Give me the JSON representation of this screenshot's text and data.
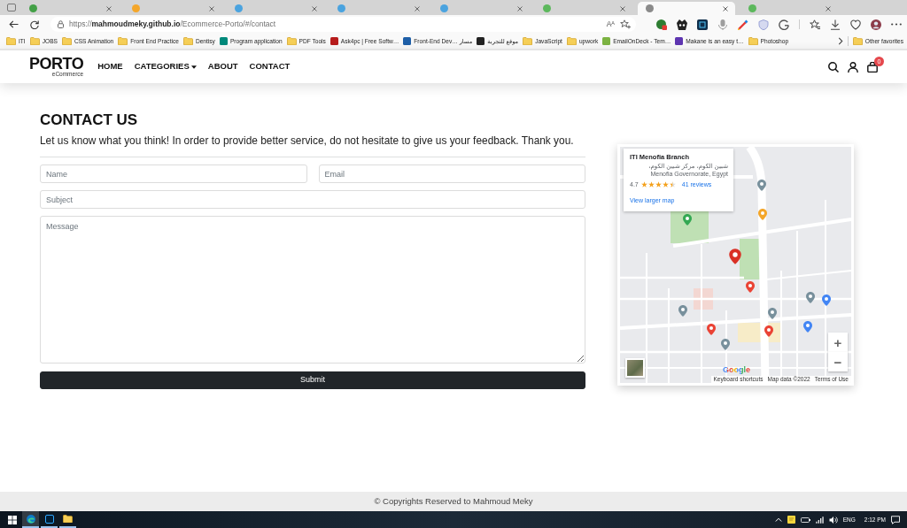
{
  "browser": {
    "tabs": [
      {
        "color": "#43a047",
        "selected": false
      },
      {
        "color": "#f4a62a",
        "selected": false
      },
      {
        "color": "#4aa3df",
        "selected": false
      },
      {
        "color": "#4aa3df",
        "selected": false
      },
      {
        "color": "#4aa3df",
        "selected": false
      },
      {
        "color": "#5cb85c",
        "selected": false
      },
      {
        "color": "#8a8a8a",
        "selected": true
      },
      {
        "color": "#5cb85c",
        "selected": false
      }
    ],
    "address": {
      "url": "https://**mahmoudmeky.github.io**/Ecommerce-Porto/#/contact"
    },
    "read_aloud": "A$^{A}$",
    "bookmarks": [
      {
        "label": "ITI",
        "kind": "folder"
      },
      {
        "label": "JOBS",
        "kind": "folder"
      },
      {
        "label": "CSS Animation",
        "kind": "folder"
      },
      {
        "label": "Front End Practice",
        "kind": "folder"
      },
      {
        "label": "Dentisy",
        "kind": "folder"
      },
      {
        "label": "Program application",
        "kind": "site",
        "color": "#00897b"
      },
      {
        "label": "PDF Tools",
        "kind": "folder"
      },
      {
        "label": "Ask4pc | Free Softw…",
        "kind": "site",
        "color": "#b71c1c"
      },
      {
        "label": "Front-End Dev… مسار",
        "kind": "site",
        "color": "#1e5fa8"
      },
      {
        "label": "موقع للتجربة",
        "kind": "site",
        "color": "#222222"
      },
      {
        "label": "JavaScript",
        "kind": "folder"
      },
      {
        "label": "upwork",
        "kind": "folder"
      },
      {
        "label": "EmailOnDeck - Tem…",
        "kind": "site",
        "color": "#7cb342"
      },
      {
        "label": "Makane is an easy t…",
        "kind": "site",
        "color": "#5e35b1"
      },
      {
        "label": "Photoshop",
        "kind": "folder"
      }
    ],
    "other_favorites": "Other favorites"
  },
  "site": {
    "logo": {
      "title": "PORTO",
      "subtitle": "eCommerce"
    },
    "nav": [
      {
        "label": "HOME",
        "dropdown": false
      },
      {
        "label": "CATEGORIES",
        "dropdown": true
      },
      {
        "label": "ABOUT",
        "dropdown": false
      },
      {
        "label": "CONTACT",
        "dropdown": false
      }
    ],
    "cart_count": "0"
  },
  "contact": {
    "title": "CONTACT US",
    "intro": "Let us know what you think! In order to provide better service, do not hesitate to give us your feedback. Thank you.",
    "name_field": {
      "placeholder": "Name"
    },
    "email_field": {
      "placeholder": "Email"
    },
    "subject_field": {
      "placeholder": "Subject"
    },
    "message_field": {
      "placeholder": "Message"
    },
    "submit": "Submit"
  },
  "map": {
    "place_card": {
      "title": "ITI Menofia Branch",
      "address": "شبين الكوم، مركز شبين الكوم، Menofia Governorate, Egypt",
      "rating": "4.7",
      "stars": 4.5,
      "reviews": "41 reviews",
      "larger_map_link": "View larger map"
    },
    "zoom_in": "+",
    "zoom_out": "−",
    "logo": "Google",
    "attribution": [
      "Keyboard shortcuts",
      "Map data ©2022",
      "Terms of Use"
    ]
  },
  "footer": {
    "copyright": "© Copyrights Reserved to Mahmoud Meky"
  },
  "taskbar": {
    "apps": [
      {
        "kind": "browser",
        "active": true
      },
      {
        "kind": "photo-editor",
        "active": false
      },
      {
        "kind": "files",
        "active": false
      }
    ],
    "language": "ENG",
    "time": "2:12 PM"
  }
}
